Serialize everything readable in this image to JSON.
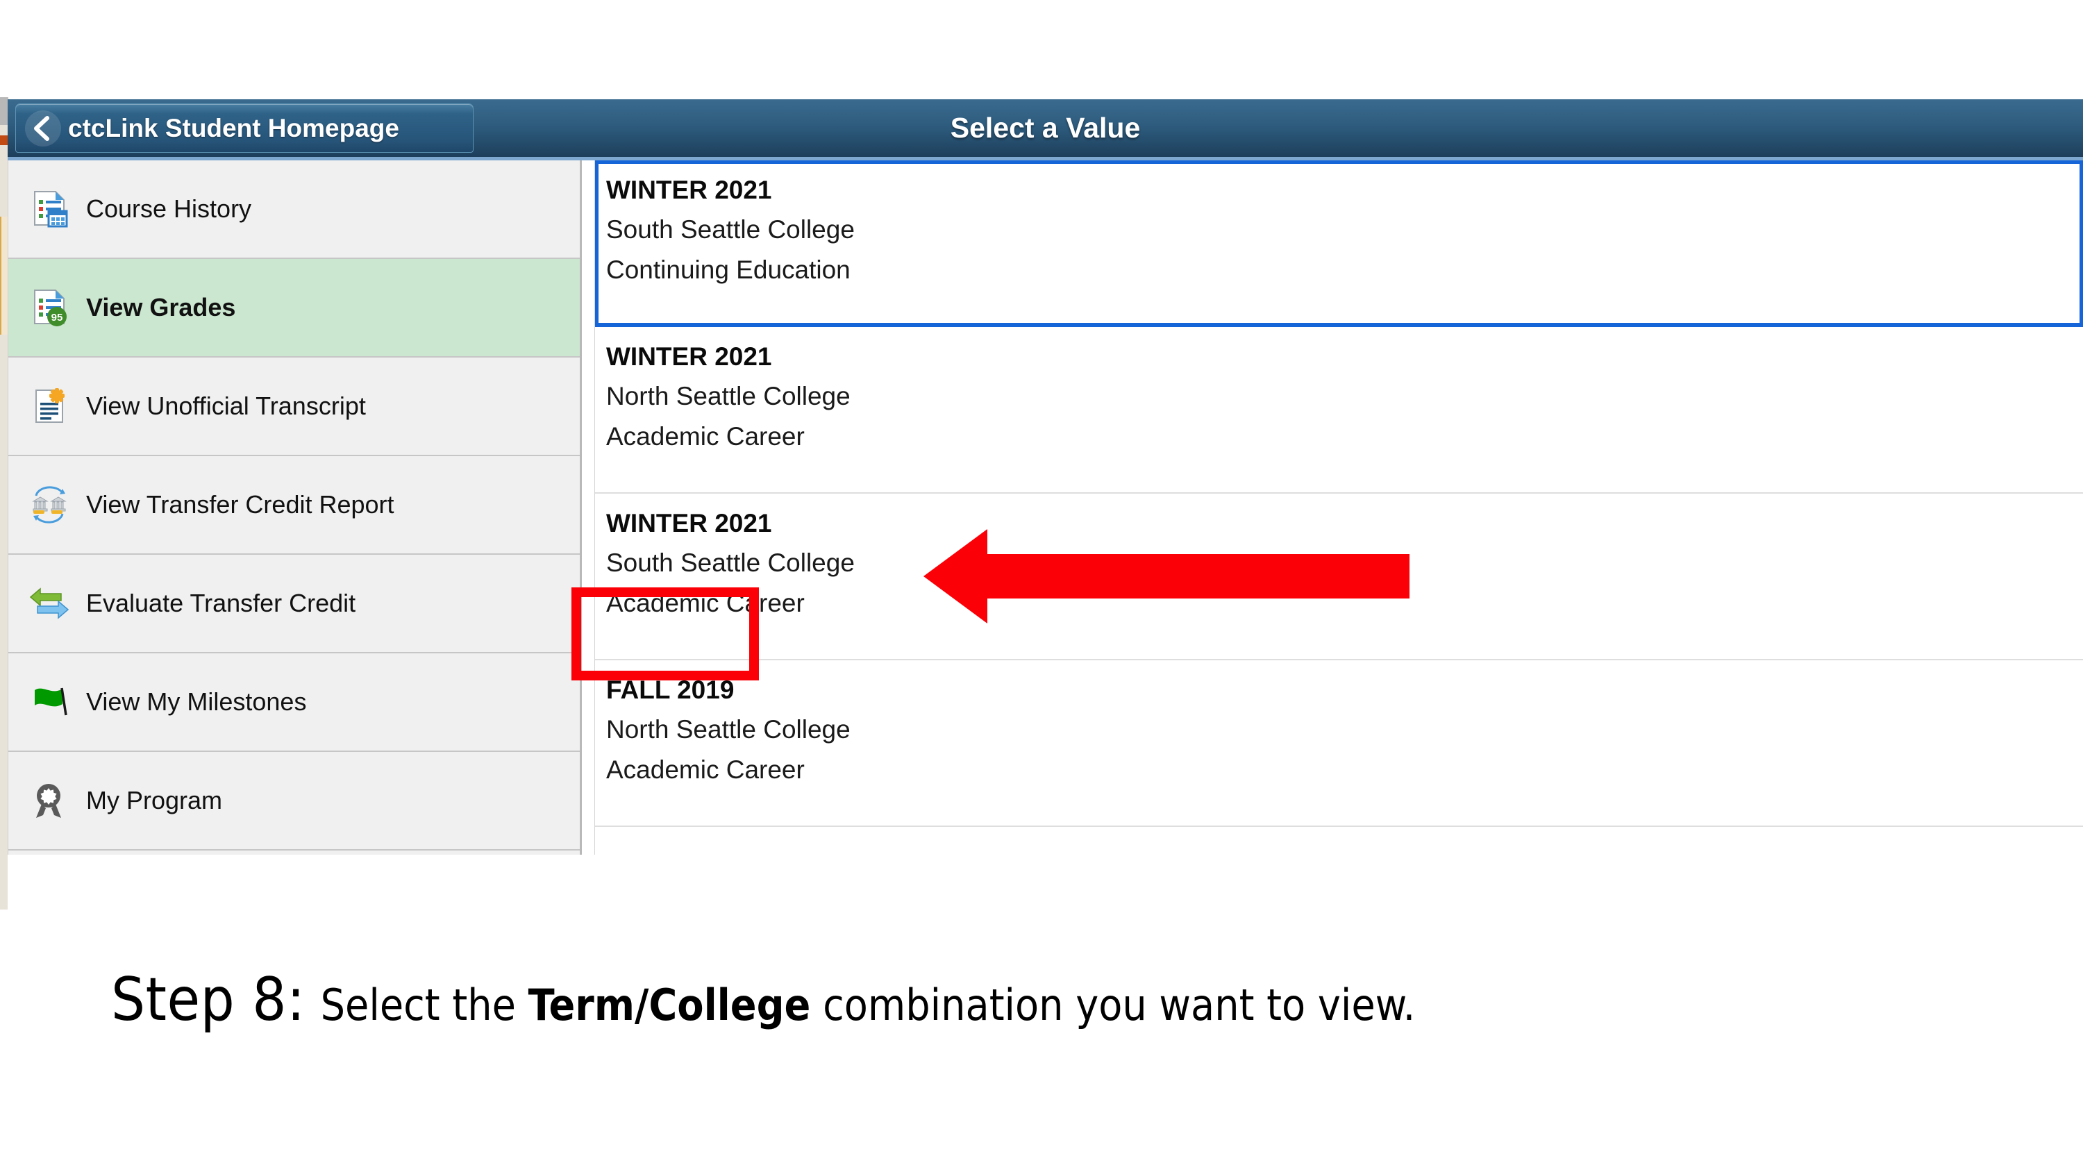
{
  "window": {
    "header": {
      "back_label": "ctcLink Student Homepage",
      "back_icon": "chevron-left-icon",
      "title": "Select a Value"
    }
  },
  "sidebar": {
    "items": [
      {
        "label": "Course History",
        "icon": "document-list-calendar-icon",
        "selected": false
      },
      {
        "label": "View Grades",
        "icon": "document-list-grade-badge-icon",
        "selected": true
      },
      {
        "label": "View Unofficial Transcript",
        "icon": "document-lines-star-icon",
        "selected": false
      },
      {
        "label": "View Transfer Credit Report",
        "icon": "two-banks-cycle-icon",
        "selected": false
      },
      {
        "label": "Evaluate Transfer Credit",
        "icon": "green-blue-arrows-icon",
        "selected": false
      },
      {
        "label": "View My Milestones",
        "icon": "green-flag-icon",
        "selected": false
      },
      {
        "label": "My Program",
        "icon": "gray-award-ribbon-icon",
        "selected": false
      }
    ]
  },
  "value_list": {
    "rows": [
      {
        "term": "WINTER 2021",
        "college": "South Seattle College",
        "career": "Continuing Education",
        "focused": true,
        "highlighted": false
      },
      {
        "term": "WINTER 2021",
        "college": "North Seattle College",
        "career": "Academic Career",
        "focused": false,
        "highlighted": false
      },
      {
        "term": "WINTER 2021",
        "college": "South Seattle College",
        "career": "Academic Career",
        "focused": false,
        "highlighted": true
      },
      {
        "term": "FALL 2019",
        "college": "North Seattle College",
        "career": "Academic Career",
        "focused": false,
        "highlighted": false
      }
    ]
  },
  "annotation": {
    "box_color": "#fb0007",
    "arrow_color": "#fb0007",
    "arrow_direction": "left",
    "arrow_name": "red-pointer-arrow"
  },
  "caption": {
    "step": "Step 8:",
    "text_before_bold": "Select the ",
    "bold_text": "Term/College",
    "text_after_bold": " combination you want to view."
  },
  "colors": {
    "header_top": "#3a6b8f",
    "header_bottom": "#1d3f5c",
    "selected_sidebar": "#cbe7cf",
    "focus_border": "#1565d8",
    "sidebar_bg": "#f0f0f0",
    "annotation_red": "#fb0007"
  }
}
